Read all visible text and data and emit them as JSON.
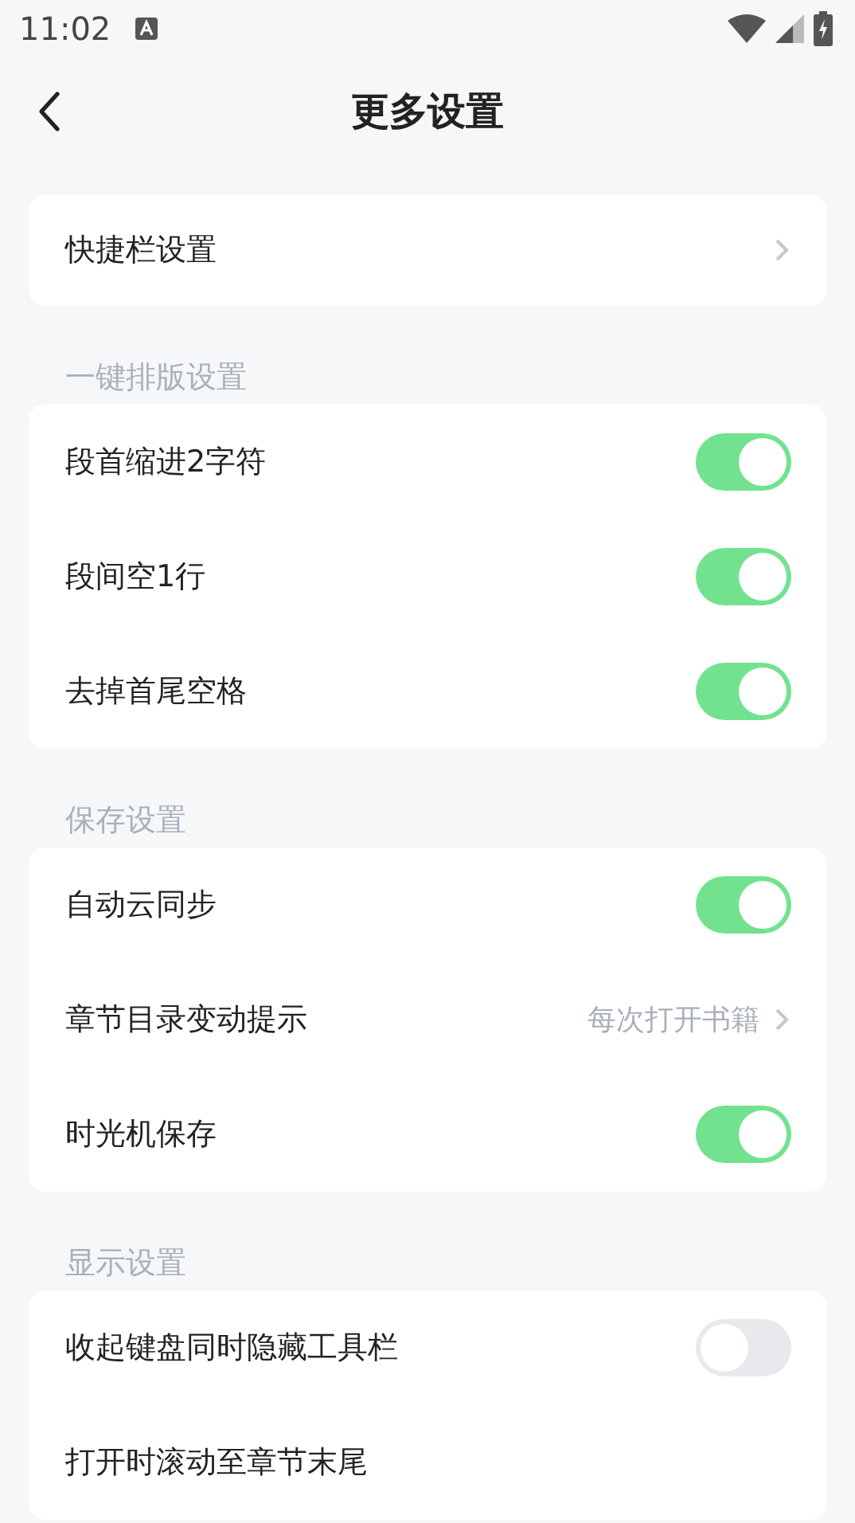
{
  "status_bar": {
    "time": "11:02"
  },
  "header": {
    "title": "更多设置"
  },
  "sections": [
    {
      "rows": [
        {
          "kind": "link",
          "label": "快捷栏设置"
        }
      ]
    },
    {
      "title": "一键排版设置",
      "rows": [
        {
          "kind": "toggle",
          "label": "段首缩进2字符",
          "on": true
        },
        {
          "kind": "toggle",
          "label": "段间空1行",
          "on": true
        },
        {
          "kind": "toggle",
          "label": "去掉首尾空格",
          "on": true
        }
      ]
    },
    {
      "title": "保存设置",
      "rows": [
        {
          "kind": "toggle",
          "label": "自动云同步",
          "on": true
        },
        {
          "kind": "link",
          "label": "章节目录变动提示",
          "value": "每次打开书籍"
        },
        {
          "kind": "toggle",
          "label": "时光机保存",
          "on": true
        }
      ]
    },
    {
      "title": "显示设置",
      "rows": [
        {
          "kind": "toggle",
          "label": "收起键盘同时隐藏工具栏",
          "on": false
        },
        {
          "kind": "plain",
          "label": "打开时滚动至章节末尾"
        }
      ]
    }
  ]
}
